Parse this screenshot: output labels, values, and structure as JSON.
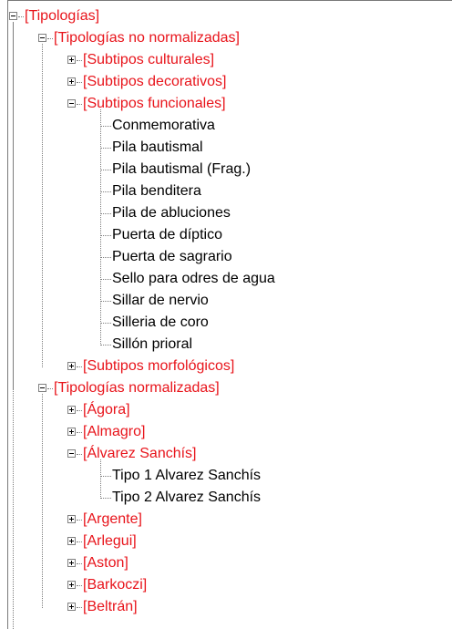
{
  "tree": {
    "root": {
      "label": "[Tipologías]",
      "children": [
        {
          "label": "[Tipologías no normalizadas]",
          "children": [
            {
              "label": "[Subtipos culturales]"
            },
            {
              "label": "[Subtipos decorativos]"
            },
            {
              "label": "[Subtipos funcionales]",
              "leaves": [
                "Conmemorativa",
                "Pila bautismal",
                "Pila bautismal (Frag.)",
                "Pila benditera",
                "Pila de abluciones",
                "Puerta de díptico",
                "Puerta de sagrario",
                "Sello para odres de agua",
                "Sillar de nervio",
                "Silleria de coro",
                "Sillón prioral"
              ]
            },
            {
              "label": "[Subtipos morfológicos]"
            }
          ]
        },
        {
          "label": "[Tipologías normalizadas]",
          "children": [
            {
              "label": "[Ágora]"
            },
            {
              "label": "[Almagro]"
            },
            {
              "label": "[Álvarez Sanchís]",
              "leaves": [
                "Tipo 1 Alvarez Sanchís",
                "Tipo 2 Alvarez Sanchís"
              ]
            },
            {
              "label": "[Argente]"
            },
            {
              "label": "[Arlegui]"
            },
            {
              "label": "[Aston]"
            },
            {
              "label": "[Barkoczi]"
            },
            {
              "label": "[Beltrán]"
            }
          ]
        }
      ]
    }
  },
  "colors": {
    "category": "#e8141b",
    "leaf": "#000000"
  }
}
